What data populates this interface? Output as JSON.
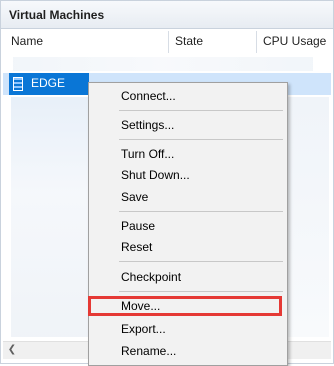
{
  "panel": {
    "title": "Virtual Machines"
  },
  "columns": {
    "name": "Name",
    "state": "State",
    "cpu": "CPU Usage"
  },
  "row": {
    "name": "EDGE"
  },
  "context_menu": {
    "items": [
      {
        "label": "Connect..."
      },
      {
        "label": "Settings..."
      },
      {
        "label": "Turn Off..."
      },
      {
        "label": "Shut Down..."
      },
      {
        "label": "Save"
      },
      {
        "label": "Pause"
      },
      {
        "label": "Reset"
      },
      {
        "label": "Checkpoint"
      },
      {
        "label": "Move..."
      },
      {
        "label": "Export..."
      },
      {
        "label": "Rename..."
      }
    ],
    "highlighted": "Move..."
  },
  "colors": {
    "selection": "#0a76d6",
    "row_highlight": "#cfe4fb",
    "annotation_box": "#e53935",
    "menu_background": "#f2f2f2"
  },
  "icons": {
    "vm": "vm-icon",
    "scroll_left": "chevron-left-icon"
  }
}
